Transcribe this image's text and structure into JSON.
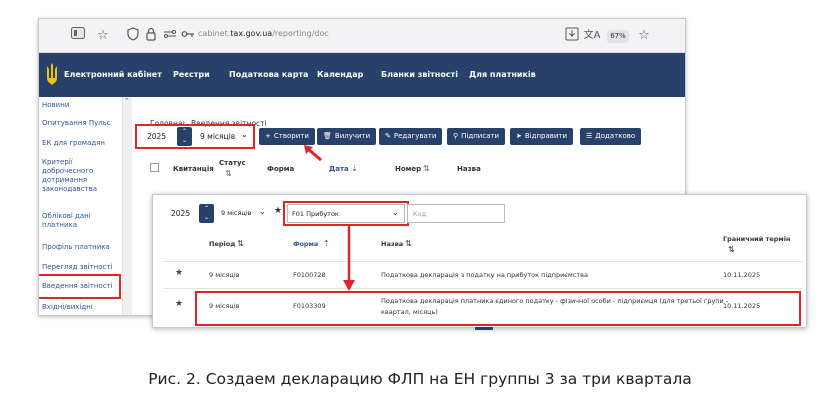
{
  "browser": {
    "url_prefix": "cabinet.",
    "url_domain": "tax.gov.ua",
    "url_path": "/reporting/doc",
    "zoom": "67%"
  },
  "topnav": {
    "brand": "Електронний кабінет",
    "items": [
      "Реєстри",
      "Податкова карта",
      "Календар",
      "Бланки звітності",
      "Для платників"
    ]
  },
  "sidebar": {
    "items": [
      "Новини",
      "Опитування Пульс",
      "ЕК для громадян",
      "Критерії доброчесного дотримання законодавства",
      "Облікові дані платника",
      "Профіль платника",
      "Перегляд звітності",
      "Введення звітності",
      "Вхідні/вихідні"
    ]
  },
  "breadcrumb": {
    "home": "Головна",
    "current": "Введення звітності"
  },
  "filters": {
    "year": "2025",
    "period": "9 місяців"
  },
  "toolbar": {
    "create": "Створити",
    "delete": "Вилучити",
    "edit": "Редагувати",
    "sign": "Підписати",
    "send": "Відправити",
    "extra": "Додатково"
  },
  "main_table": {
    "headers": [
      "Квитанція",
      "Статус",
      "Форма",
      "Дата",
      "Номер",
      "Назва"
    ]
  },
  "overlay": {
    "year": "2025",
    "period": "9 місяців",
    "form_filter": "F01 Прибуток",
    "code_placeholder": "Код",
    "headers": {
      "period": "Період",
      "form": "Форма",
      "name": "Назва",
      "deadline": "Граничний термін"
    },
    "rows": [
      {
        "period": "9 місяців",
        "form": "F0100728",
        "name": "Податкова декларація з податку на прибуток підприємства",
        "deadline": "10.11.2025"
      },
      {
        "period": "9 місяців",
        "form": "F0103309",
        "name_line1": "Податкова декларація платника єдиного податку - фізичної особи - підприємця (для третьої групи -",
        "name_line2": "квартал, місяць)",
        "deadline": "10.11.2025"
      }
    ]
  },
  "caption": "Рис. 2. Создаем декларацию ФЛП на ЕН группы 3 за три квартала",
  "colors": {
    "navy": "#27416a",
    "highlight": "#e1232a",
    "link": "#2f5597"
  },
  "icons": [
    "sidebar-toggle-icon",
    "star-icon",
    "shield-icon",
    "lock-icon",
    "key-icon",
    "download-icon",
    "translate-icon",
    "bookmark-icon",
    "trident-icon",
    "chevron-right-icon",
    "chevron-down-icon",
    "plus-icon",
    "trash-icon",
    "pencil-icon",
    "sign-icon",
    "send-icon",
    "list-icon",
    "sort-icon",
    "red-arrow-icon"
  ]
}
